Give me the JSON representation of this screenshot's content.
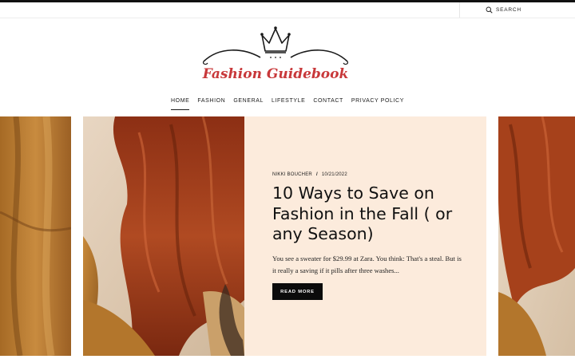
{
  "search": {
    "label": "SEARCH",
    "icon": "search-icon"
  },
  "logo": {
    "text": "Fashion Guidebook",
    "icon": "crown-icon",
    "color": "#c8383a"
  },
  "nav": {
    "items": [
      {
        "label": "HOME",
        "active": true
      },
      {
        "label": "FASHION"
      },
      {
        "label": "GENERAL"
      },
      {
        "label": "LIFESTYLE"
      },
      {
        "label": "CONTACT"
      },
      {
        "label": "PRIVACY POLICY"
      }
    ]
  },
  "featured": {
    "author": "NIKKI BOUCHER",
    "separator": "/",
    "date": "10/21/2022",
    "title": "10 Ways to Save on Fashion in the Fall ( or any Season)",
    "excerpt": "You see a sweater for $29.99 at Zara. You think: That's a steal. But is it really a saving if it pills after three washes...",
    "button": "READ MORE",
    "card_color": "#fcebdc"
  }
}
